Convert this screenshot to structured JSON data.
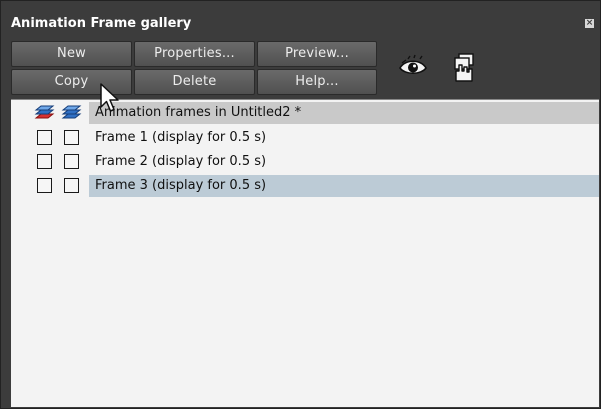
{
  "window": {
    "title": "Animation Frame gallery",
    "close_glyph": "×"
  },
  "toolbar": {
    "new_label": "New",
    "properties_label": "Properties...",
    "preview_label": "Preview...",
    "copy_label": "Copy",
    "delete_label": "Delete",
    "help_label": "Help..."
  },
  "tools": [
    {
      "icon": "eye-icon"
    },
    {
      "icon": "frames-hand-icon"
    }
  ],
  "list": {
    "header": "Animation frames in Untitled2 *",
    "frames": [
      {
        "label": "Frame 1 (display for 0.5 s)",
        "selected": false
      },
      {
        "label": "Frame 2 (display for 0.5 s)",
        "selected": false
      },
      {
        "label": "Frame 3 (display for 0.5 s)",
        "selected": true
      }
    ]
  },
  "colors": {
    "panel_bg": "#3c3c3c",
    "list_bg": "#f3f3f3",
    "header_row": "#c9c9c9",
    "selected_row": "#bccbd6",
    "layer_blue": "#2f6fc4",
    "layer_red": "#d63030"
  }
}
